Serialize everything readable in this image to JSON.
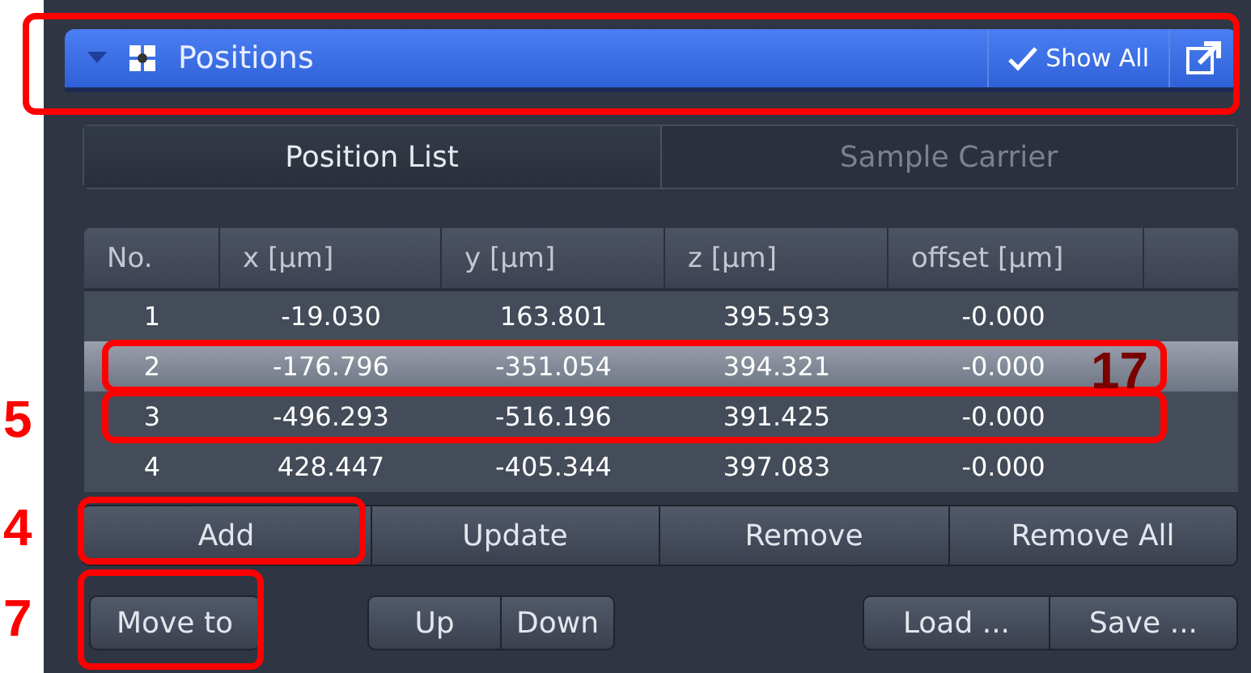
{
  "panel": {
    "title": "Positions",
    "show_all": {
      "label": "Show All",
      "checked": true
    }
  },
  "tabs": [
    {
      "label": "Position List",
      "selected": true
    },
    {
      "label": "Sample Carrier",
      "selected": false
    }
  ],
  "table": {
    "columns": [
      "No.",
      "x [µm]",
      "y [µm]",
      "z [µm]",
      "offset [µm]"
    ],
    "rows": [
      {
        "cells": [
          "1",
          "-19.030",
          "163.801",
          "395.593",
          "-0.000"
        ],
        "selected": false
      },
      {
        "cells": [
          "2",
          "-176.796",
          "-351.054",
          "394.321",
          "-0.000"
        ],
        "selected": true
      },
      {
        "cells": [
          "3",
          "-496.293",
          "-516.196",
          "391.425",
          "-0.000"
        ],
        "selected": false
      },
      {
        "cells": [
          "4",
          "428.447",
          "-405.344",
          "397.083",
          "-0.000"
        ],
        "selected": false
      }
    ]
  },
  "list_buttons": [
    "Add",
    "Update",
    "Remove",
    "Remove All"
  ],
  "move_button": "Move to",
  "order_buttons": [
    "Up",
    "Down"
  ],
  "file_buttons": [
    "Load ...",
    "Save ..."
  ],
  "annotations": [
    {
      "kind": "frame"
    },
    {
      "kind": "frame",
      "label": "17"
    },
    {
      "kind": "frame",
      "label": "5"
    },
    {
      "kind": "frame",
      "label": "4"
    },
    {
      "kind": "frame",
      "label": "7"
    }
  ]
}
